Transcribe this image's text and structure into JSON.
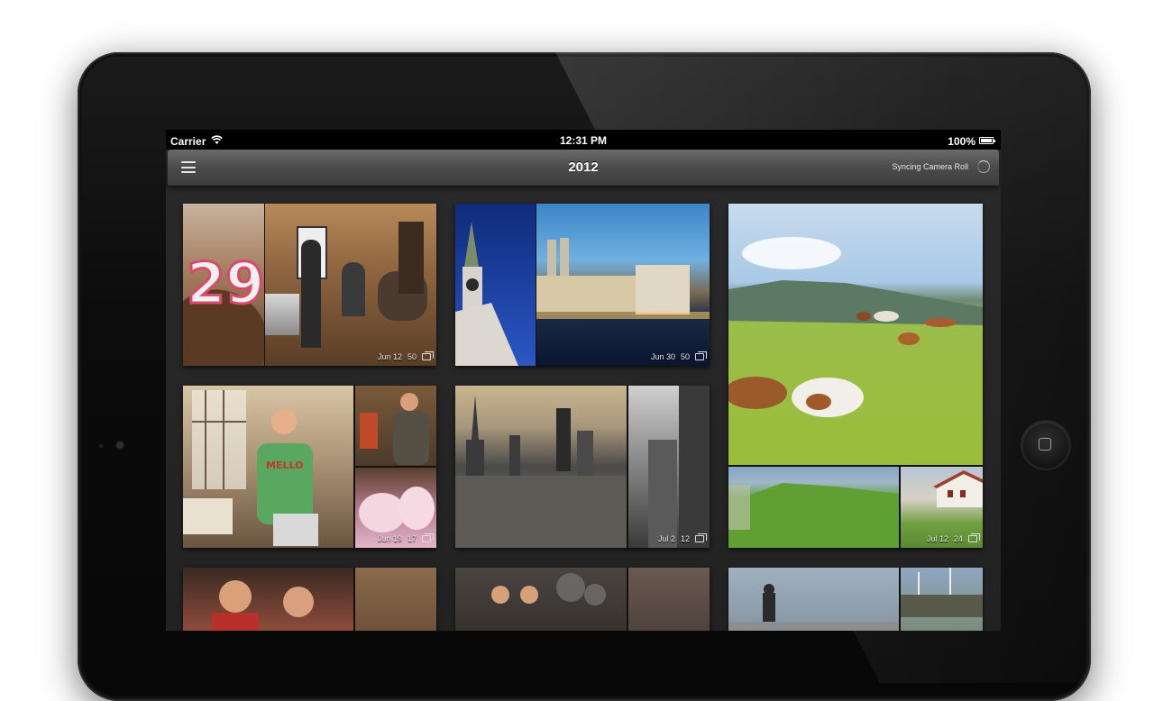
{
  "status_bar": {
    "carrier": "Carrier",
    "time": "12:31 PM",
    "battery": "100%"
  },
  "nav": {
    "title": "2012",
    "sync_label": "Syncing Camera Roll"
  },
  "tiles": [
    {
      "date": "Jun 12",
      "count": "50"
    },
    {
      "date": "Jun 30",
      "count": "50"
    },
    {
      "date": "Jul 12",
      "count": "24"
    },
    {
      "date": "Jun 19",
      "count": "17"
    },
    {
      "date": "Jul 2",
      "count": "12"
    }
  ]
}
